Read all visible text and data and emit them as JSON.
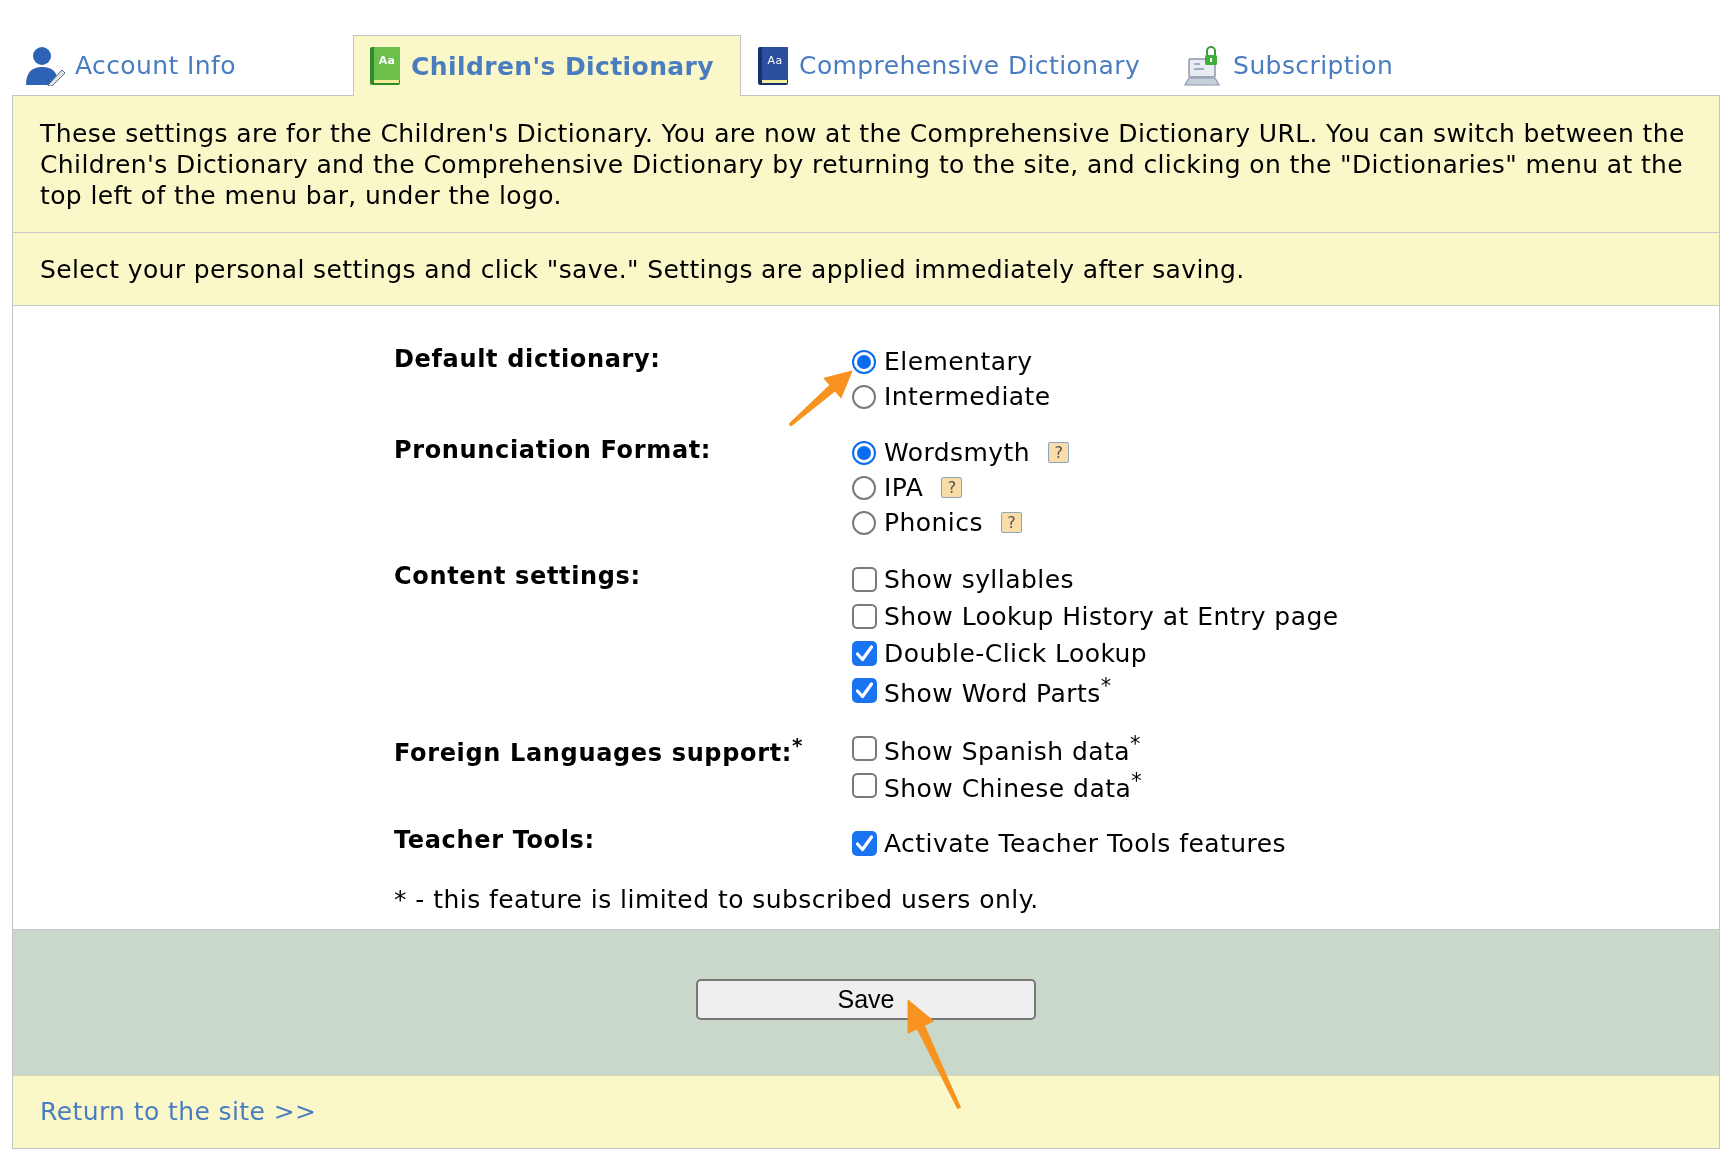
{
  "tabs": [
    {
      "label": "Account Info",
      "selected": false
    },
    {
      "label": "Children's Dictionary",
      "selected": true,
      "icon_text": "Aa"
    },
    {
      "label": "Comprehensive Dictionary",
      "selected": false,
      "icon_text": "Aa"
    },
    {
      "label": "Subscription",
      "selected": false
    }
  ],
  "notice": "These settings are for the Children's Dictionary. You are now at the Comprehensive Dictionary URL. You can switch between the Children's Dictionary and the Comprehensive Dictionary by returning to the site, and clicking on the \"Dictionaries\" menu at the top left of the menu bar, under the logo.",
  "instructions": "Select your personal settings and click \"save.\" Settings are applied immediately after saving.",
  "settings": [
    {
      "label": "Default dictionary:",
      "options": [
        {
          "kind": "radio",
          "label": "Elementary",
          "selected": true
        },
        {
          "kind": "radio",
          "label": "Intermediate",
          "selected": false
        }
      ]
    },
    {
      "label": "Pronunciation Format:",
      "options": [
        {
          "kind": "radio",
          "label": "Wordsmyth",
          "selected": true,
          "help": "?"
        },
        {
          "kind": "radio",
          "label": "IPA",
          "selected": false,
          "help": "?"
        },
        {
          "kind": "radio",
          "label": "Phonics",
          "selected": false,
          "help": "?"
        }
      ]
    },
    {
      "label": "Content settings:",
      "options": [
        {
          "kind": "checkbox",
          "label": "Show syllables",
          "checked": false
        },
        {
          "kind": "checkbox",
          "label": "Show Lookup History at Entry page",
          "checked": false
        },
        {
          "kind": "checkbox",
          "label": "Double-Click Lookup",
          "checked": true
        },
        {
          "kind": "checkbox",
          "label": "Show Word Parts$^{*}$",
          "checked": true
        }
      ]
    },
    {
      "label": "Foreign Languages support:$^{*}$",
      "options": [
        {
          "kind": "checkbox",
          "label": "Show Spanish data$^{*}$",
          "checked": false
        },
        {
          "kind": "checkbox",
          "label": "Show Chinese data$^{*}$",
          "checked": false
        }
      ]
    },
    {
      "label": "Teacher Tools:",
      "options": [
        {
          "kind": "checkbox",
          "label": "Activate Teacher Tools features",
          "checked": true
        }
      ]
    }
  ],
  "footnote": "* - this feature is limited to subscribed users only.",
  "save_button": "Save",
  "return_link": "Return to the site >>",
  "annotations": [
    {
      "kind": "arrow"
    },
    {
      "kind": "arrow"
    }
  ]
}
